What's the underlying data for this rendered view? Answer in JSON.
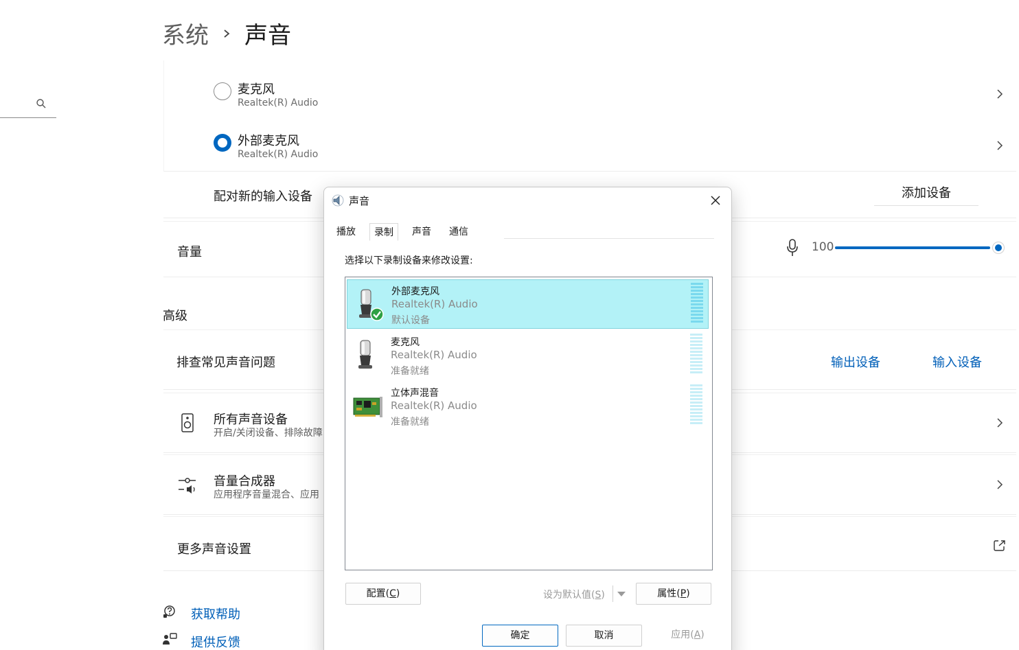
{
  "breadcrumb": {
    "parent": "系统",
    "current": "声音"
  },
  "search": {
    "placeholder": ""
  },
  "inputs": [
    {
      "name": "麦克风",
      "driver": "Realtek(R) Audio",
      "selected": false
    },
    {
      "name": "外部麦克风",
      "driver": "Realtek(R) Audio",
      "selected": true
    }
  ],
  "pair": {
    "label": "配对新的输入设备",
    "button": "添加设备"
  },
  "volume": {
    "label": "音量",
    "value": "100",
    "level": 100
  },
  "advanced": {
    "title": "高级",
    "troubleshoot": {
      "label": "排查常见声音问题",
      "output_link": "输出设备",
      "input_link": "输入设备"
    },
    "all_devices": {
      "label": "所有声音设备",
      "sub": "开启/关闭设备、排除故障"
    },
    "mixer": {
      "label": "音量合成器",
      "sub": "应用程序音量混合、应用"
    },
    "more": {
      "label": "更多声音设置"
    }
  },
  "help": {
    "get_help": "获取帮助",
    "feedback": "提供反馈"
  },
  "dialog": {
    "title": "声音",
    "tabs": [
      "播放",
      "录制",
      "声音",
      "通信"
    ],
    "active_tab": 1,
    "instruction": "选择以下录制设备来修改设置:",
    "devices": [
      {
        "name": "外部麦克风",
        "driver": "Realtek(R) Audio",
        "status": "默认设备",
        "icon": "microphone-default-icon"
      },
      {
        "name": "麦克风",
        "driver": "Realtek(R) Audio",
        "status": "准备就绪",
        "icon": "microphone-icon"
      },
      {
        "name": "立体声混音",
        "driver": "Realtek(R) Audio",
        "status": "准备就绪",
        "icon": "sound-card-icon"
      }
    ],
    "buttons": {
      "configure": "配置(",
      "configure_key": "C",
      "set_default": "设为默认值(",
      "set_default_key": "S",
      "properties": "属性(",
      "properties_key": "P",
      "ok": "确定",
      "cancel": "取消",
      "apply": "应用(",
      "apply_key": "A",
      "close_paren": ")"
    }
  }
}
